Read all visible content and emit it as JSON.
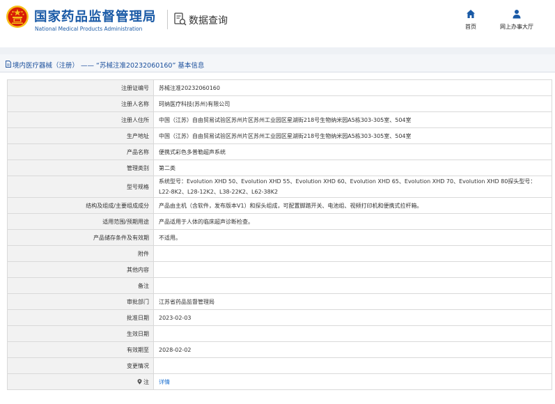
{
  "header": {
    "brand_cn": "国家药品监督管理局",
    "brand_en": "National Medical Products Administration",
    "query_label": "数据查询",
    "nav": [
      {
        "label": "首页",
        "icon": "home-icon"
      },
      {
        "label": "网上办事大厅",
        "icon": "user-icon"
      }
    ]
  },
  "breadcrumb": {
    "title": "境内医疗器械（注册） —— “苏械注准20232060160” 基本信息"
  },
  "colors": {
    "brand_blue": "#1a5aa6",
    "link_blue": "#1a6fd0",
    "label_bg": "#f2f2f2",
    "emblem_red": "#d81e06",
    "emblem_gold": "#f7c21a"
  },
  "record": [
    {
      "label": "注册证编号",
      "value": "苏械注准20232060160"
    },
    {
      "label": "注册人名称",
      "value": "珂纳医疗科技(苏州)有限公司"
    },
    {
      "label": "注册人住所",
      "value": "中国（江苏）自由贸易试验区苏州片区苏州工业园区星湖街218号生物纳米园A5栋303-305室、504室"
    },
    {
      "label": "生产地址",
      "value": "中国（江苏）自由贸易试验区苏州片区苏州工业园区星湖街218号生物纳米园A5栋303-305室、504室"
    },
    {
      "label": "产品名称",
      "value": "便携式彩色多普勒超声系统"
    },
    {
      "label": "管理类别",
      "value": "第二类"
    },
    {
      "label": "型号规格",
      "value": "系统型号：Evolution XHD 50、Evolution XHD 55、Evolution XHD 60、Evolution XHD 65、Evolution XHD 70、Evolution XHD 80探头型号：L22-8K2、L28-12K2、L38-22K2、L62-38K2"
    },
    {
      "label": "结构及组成/主要组成成分",
      "value": "产品由主机（含软件，发布版本V1）和探头组成，可配置脚踏开关、电池组、视频打印机和便携式拉杆箱。"
    },
    {
      "label": "适用范围/预期用途",
      "value": "产品适用于人体的临床超声诊断检查。"
    },
    {
      "label": "产品储存条件及有效期",
      "value": "不适用。"
    },
    {
      "label": "附件",
      "value": ""
    },
    {
      "label": "其他内容",
      "value": ""
    },
    {
      "label": "备注",
      "value": ""
    },
    {
      "label": "审批部门",
      "value": "江苏省药品监督管理局"
    },
    {
      "label": "批准日期",
      "value": "2023-02-03"
    },
    {
      "label": "生效日期",
      "value": ""
    },
    {
      "label": "有效期至",
      "value": "2028-02-02"
    },
    {
      "label": "变更情况",
      "value": ""
    },
    {
      "label": "注",
      "value": "详情",
      "icon": "pin-icon"
    }
  ]
}
